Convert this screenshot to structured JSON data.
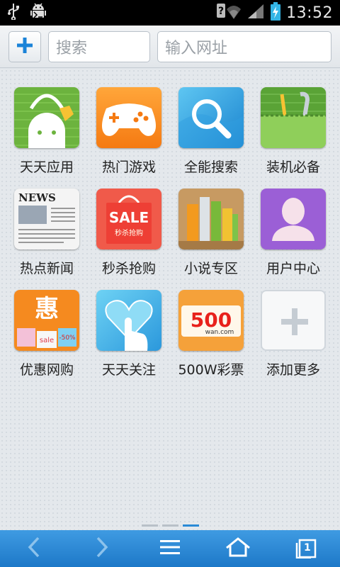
{
  "status_bar": {
    "time": "13:52",
    "icons": [
      "usb-icon",
      "android-debug-icon",
      "wifi-question-icon",
      "signal-icon",
      "battery-charging-icon"
    ]
  },
  "toolbar": {
    "add_icon": "plus-icon",
    "search_placeholder": "搜索",
    "url_placeholder": "输入网址"
  },
  "tiles": [
    {
      "label": "天天应用",
      "icon": "android-shopping-bag-icon"
    },
    {
      "label": "热门游戏",
      "icon": "gamepad-icon"
    },
    {
      "label": "全能搜索",
      "icon": "magnifier-icon"
    },
    {
      "label": "装机必备",
      "icon": "tools-icon"
    },
    {
      "label": "热点新闻",
      "icon": "newspaper-icon",
      "badge": "NEWS"
    },
    {
      "label": "秒杀抢购",
      "icon": "sale-bag-icon",
      "badge": "SALE",
      "badge_sub": "秒杀抢购"
    },
    {
      "label": "小说专区",
      "icon": "books-icon"
    },
    {
      "label": "用户中心",
      "icon": "user-silhouette-icon"
    },
    {
      "label": "优惠网购",
      "icon": "discount-bags-icon",
      "badge": "惠",
      "badge_sub": "sale",
      "badge_sub2": "-50%"
    },
    {
      "label": "天天关注",
      "icon": "heart-touch-icon"
    },
    {
      "label": "500W彩票",
      "icon": "lottery-500-icon",
      "badge": "500",
      "badge_sub": "wan.com"
    },
    {
      "label": "添加更多",
      "icon": "add-more-icon"
    }
  ],
  "pager": {
    "pages": 3,
    "current": 3
  },
  "bottom_nav": [
    "back-arrow-icon",
    "forward-arrow-icon",
    "menu-icon",
    "home-icon",
    "tabs-icon"
  ],
  "bottom_nav_tab_count": "1",
  "colors": {
    "accent_blue": "#2a8ad6",
    "bottom_bar": "#2585d2",
    "background": "#e4e8ec"
  }
}
